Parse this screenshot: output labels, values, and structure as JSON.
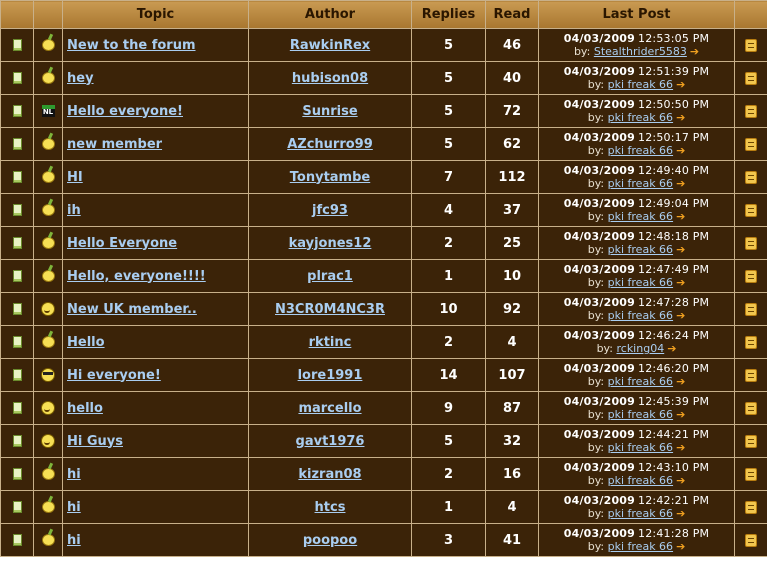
{
  "table": {
    "headers": {
      "topic": "Topic",
      "author": "Author",
      "replies": "Replies",
      "read": "Read",
      "last_post": "Last Post"
    },
    "last_post_by_prefix": "by:",
    "rows": [
      {
        "icon": "wave-emote-icon",
        "topic": "New to the forum",
        "author": "RawkinRex",
        "replies": "5",
        "read": "46",
        "date": "04/03/2009",
        "time": "12:53:05 PM",
        "last_user": "Stealthrider5583"
      },
      {
        "icon": "wave-emote-icon",
        "topic": "hey",
        "author": "hubison08",
        "replies": "5",
        "read": "40",
        "date": "04/03/2009",
        "time": "12:51:39 PM",
        "last_user": "pki freak 66"
      },
      {
        "icon": "flag-nl-emote-icon",
        "topic": "Hello everyone!",
        "author": "Sunrise",
        "replies": "5",
        "read": "72",
        "date": "04/03/2009",
        "time": "12:50:50 PM",
        "last_user": "pki freak 66"
      },
      {
        "icon": "wave-emote-icon",
        "topic": "new member",
        "author": "AZchurro99",
        "replies": "5",
        "read": "62",
        "date": "04/03/2009",
        "time": "12:50:17 PM",
        "last_user": "pki freak 66"
      },
      {
        "icon": "wave-emote-icon",
        "topic": "HI",
        "author": "Tonytambe",
        "replies": "7",
        "read": "112",
        "date": "04/03/2009",
        "time": "12:49:40 PM",
        "last_user": "pki freak 66"
      },
      {
        "icon": "wave-emote-icon",
        "topic": "ih",
        "author": "jfc93",
        "replies": "4",
        "read": "37",
        "date": "04/03/2009",
        "time": "12:49:04 PM",
        "last_user": "pki freak 66"
      },
      {
        "icon": "wave-emote-icon",
        "topic": "Hello Everyone",
        "author": "kayjones12",
        "replies": "2",
        "read": "25",
        "date": "04/03/2009",
        "time": "12:48:18 PM",
        "last_user": "pki freak 66"
      },
      {
        "icon": "wave-emote-icon",
        "topic": "Hello, everyone!!!!",
        "author": "plrac1",
        "replies": "1",
        "read": "10",
        "date": "04/03/2009",
        "time": "12:47:49 PM",
        "last_user": "pki freak 66"
      },
      {
        "icon": "smile-emote-icon",
        "topic": "New UK member..",
        "author": "N3CR0M4NC3R",
        "replies": "10",
        "read": "92",
        "date": "04/03/2009",
        "time": "12:47:28 PM",
        "last_user": "pki freak 66"
      },
      {
        "icon": "wave-emote-icon",
        "topic": "Hello",
        "author": "rktinc",
        "replies": "2",
        "read": "4",
        "date": "04/03/2009",
        "time": "12:46:24 PM",
        "last_user": "rcking04"
      },
      {
        "icon": "cool-emote-icon",
        "topic": "Hi everyone!",
        "author": "lore1991",
        "replies": "14",
        "read": "107",
        "date": "04/03/2009",
        "time": "12:46:20 PM",
        "last_user": "pki freak 66"
      },
      {
        "icon": "smile-emote-icon",
        "topic": "hello",
        "author": "marcello",
        "replies": "9",
        "read": "87",
        "date": "04/03/2009",
        "time": "12:45:39 PM",
        "last_user": "pki freak 66"
      },
      {
        "icon": "smile-emote-icon",
        "topic": "Hi Guys",
        "author": "gavt1976",
        "replies": "5",
        "read": "32",
        "date": "04/03/2009",
        "time": "12:44:21 PM",
        "last_user": "pki freak 66"
      },
      {
        "icon": "wave-emote-icon",
        "topic": "hi",
        "author": "kizran08",
        "replies": "2",
        "read": "16",
        "date": "04/03/2009",
        "time": "12:43:10 PM",
        "last_user": "pki freak 66"
      },
      {
        "icon": "wave-emote-icon",
        "topic": "hi",
        "author": "htcs",
        "replies": "1",
        "read": "4",
        "date": "04/03/2009",
        "time": "12:42:21 PM",
        "last_user": "pki freak 66"
      },
      {
        "icon": "wave-emote-icon",
        "topic": "hi",
        "author": "poopoo",
        "replies": "3",
        "read": "41",
        "date": "04/03/2009",
        "time": "12:41:28 PM",
        "last_user": "pki freak 66"
      }
    ]
  },
  "colors": {
    "row_background": "#3b2308",
    "header_background": "#b8853f",
    "link": "#a9cdf0",
    "border": "#c8b08a",
    "arrow": "#f0a020"
  }
}
